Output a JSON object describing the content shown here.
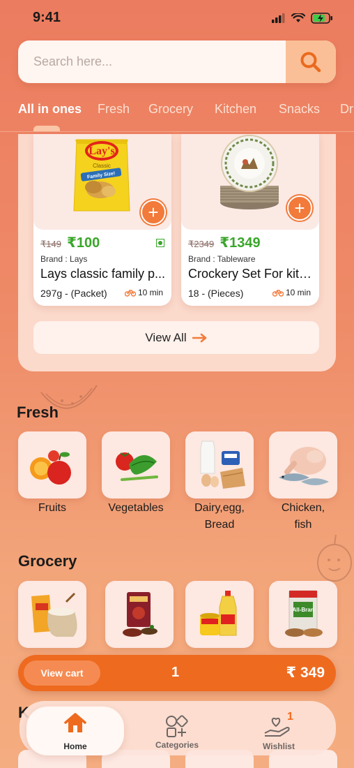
{
  "status": {
    "time": "9:41"
  },
  "search": {
    "placeholder": "Search here..."
  },
  "tabs": [
    "All in ones",
    "Fresh",
    "Grocery",
    "Kitchen",
    "Snacks",
    "Dr"
  ],
  "products": [
    {
      "old_price": "₹149",
      "price": "₹100",
      "brand": "Brand : Lays",
      "name": "Lays classic family p...",
      "qty": "297g - (Packet)",
      "delivery": "10 min",
      "img_label": "Lay's",
      "img_sub": "Classic",
      "img_tag": "Family Size!"
    },
    {
      "old_price": "₹2349",
      "price": "₹1349",
      "brand": "Brand : Tableware",
      "name": "Crockery Set For kitc...",
      "qty": "18 - (Pieces)",
      "delivery": "10 min"
    }
  ],
  "view_all": {
    "label": "View All"
  },
  "fresh": {
    "title": "Fresh",
    "items": [
      {
        "label": "Fruits",
        "icon": "fruits-image"
      },
      {
        "label": "Vegetables",
        "icon": "vegetables-image"
      },
      {
        "label": "Dairy,egg,",
        "label2": "Bread",
        "icon": "dairy-image"
      },
      {
        "label": "Chicken,",
        "label2": "fish",
        "icon": "chicken-image"
      }
    ]
  },
  "grocery": {
    "title": "Grocery",
    "items": [
      {
        "icon": "atta-image"
      },
      {
        "icon": "masala-image"
      },
      {
        "icon": "oil-image"
      },
      {
        "icon": "cereal-image",
        "text": "All-Bran"
      }
    ]
  },
  "cart": {
    "button_label": "View cart",
    "count": "1",
    "total": "₹ 349"
  },
  "peek": {
    "title": "K"
  },
  "nav": {
    "home": "Home",
    "categories": "Categories",
    "wishlist": "Wishlist",
    "wishlist_badge": "1"
  },
  "colors": {
    "accent": "#ee6a1f",
    "price_green": "#3aa62b"
  }
}
